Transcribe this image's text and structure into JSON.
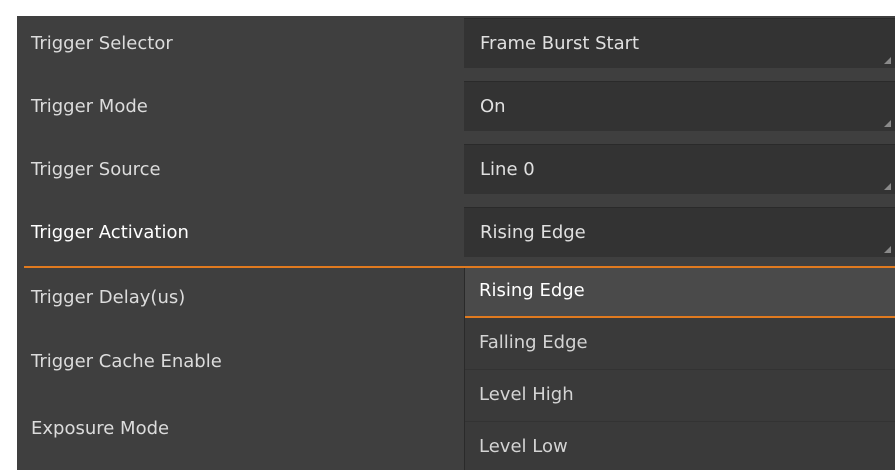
{
  "properties": [
    {
      "label": "Trigger Selector",
      "value": "Frame Burst Start"
    },
    {
      "label": "Trigger Mode",
      "value": "On"
    },
    {
      "label": "Trigger Source",
      "value": "Line 0"
    },
    {
      "label": "Trigger Activation",
      "value": "Rising Edge"
    },
    {
      "label": "Trigger Delay(us)",
      "value": ""
    },
    {
      "label": "Trigger Cache Enable",
      "value": ""
    },
    {
      "label": "Exposure Mode",
      "value": ""
    }
  ],
  "dropdown": {
    "options": [
      "Rising Edge",
      "Falling Edge",
      "Level High",
      "Level Low"
    ],
    "selected": "Rising Edge"
  },
  "colors": {
    "accent": "#e07a1f",
    "panel_bg": "#3f3f3f",
    "field_bg": "#333333"
  }
}
